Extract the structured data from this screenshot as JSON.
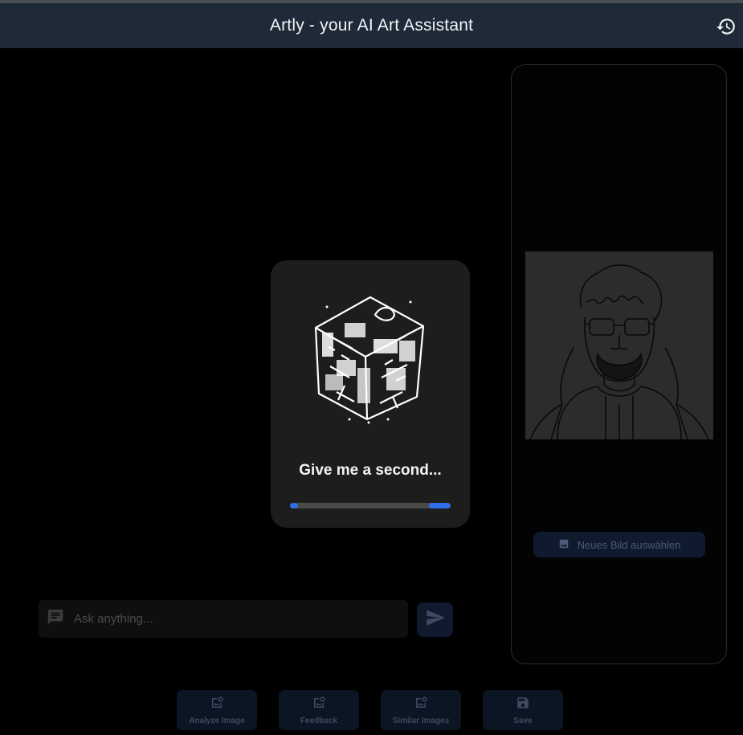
{
  "header": {
    "title": "Artly - your AI Art Assistant",
    "history_icon": "history-icon"
  },
  "loading": {
    "message": "Give me a second...",
    "progress": 0.15,
    "animation": "rotating-sketch-cube"
  },
  "chat": {
    "placeholder": "Ask anything...",
    "input_icon": "chat-bubble-icon",
    "send_icon": "send-icon"
  },
  "side_panel": {
    "image_alt": "Line-art portrait of a man with curly hair, glasses and a hoodie",
    "new_image_label": "Neues Bild auswählen",
    "new_image_icon": "image-icon"
  },
  "actions": [
    {
      "label": "Analyze Image",
      "icon": "image-search-icon"
    },
    {
      "label": "Feedback",
      "icon": "image-feedback-icon"
    },
    {
      "label": "Similar Images",
      "icon": "image-search-icon"
    },
    {
      "label": "Save",
      "icon": "save-icon"
    }
  ],
  "colors": {
    "header_bg": "#1e2a38",
    "accent": "#2f6fe8",
    "modal_bg": "#1d1d1d",
    "page_bg": "#000000"
  }
}
